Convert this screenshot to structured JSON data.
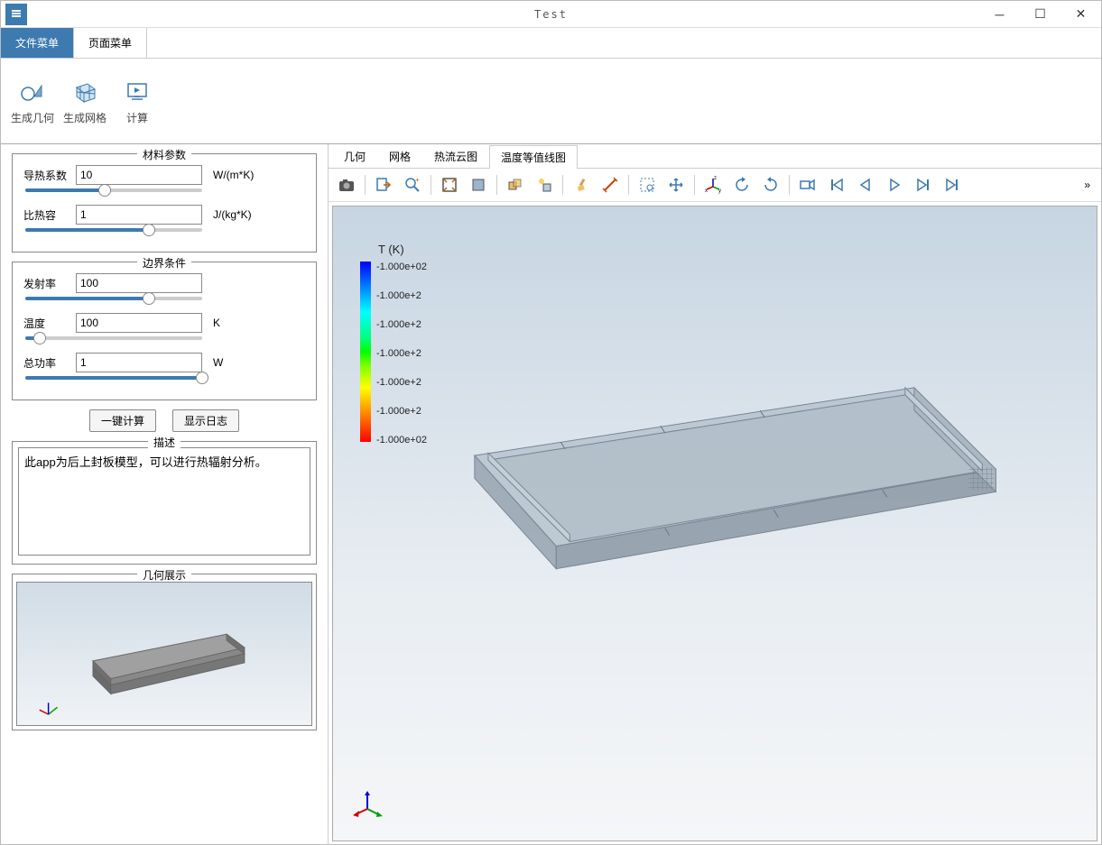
{
  "window": {
    "title": "Test"
  },
  "ribbon": {
    "tabs": [
      "文件菜单",
      "页面菜单"
    ],
    "active": 0,
    "buttons": [
      {
        "label": "生成几何"
      },
      {
        "label": "生成网格"
      },
      {
        "label": "计算"
      }
    ]
  },
  "sidebar": {
    "material_section": "材料参数",
    "thermal_cond": {
      "label": "导热系数",
      "value": "10",
      "unit": "W/(m*K)",
      "pos": 45
    },
    "heat_cap": {
      "label": "比热容",
      "value": "1",
      "unit": "J/(kg*K)",
      "pos": 70
    },
    "bc_section": "边界条件",
    "emissivity": {
      "label": "发射率",
      "value": "100",
      "unit": "",
      "pos": 70
    },
    "temperature": {
      "label": "温度",
      "value": "100",
      "unit": "K",
      "pos": 8
    },
    "power": {
      "label": "总功率",
      "value": "1",
      "unit": "W",
      "pos": 100
    },
    "btn_compute": "一键计算",
    "btn_log": "显示日志",
    "desc_section": "描述",
    "desc_text": "此app为后上封板模型，可以进行热辐射分析。",
    "preview_section": "几何展示"
  },
  "viewport": {
    "tabs": [
      "几何",
      "网格",
      "热流云图",
      "温度等值线图"
    ],
    "active": 3,
    "colorbar": {
      "title": "T (K)",
      "ticks": [
        "-1.000e+02",
        "-1.000e+2",
        "-1.000e+2",
        "-1.000e+2",
        "-1.000e+2",
        "-1.000e+2",
        "-1.000e+02"
      ]
    }
  }
}
